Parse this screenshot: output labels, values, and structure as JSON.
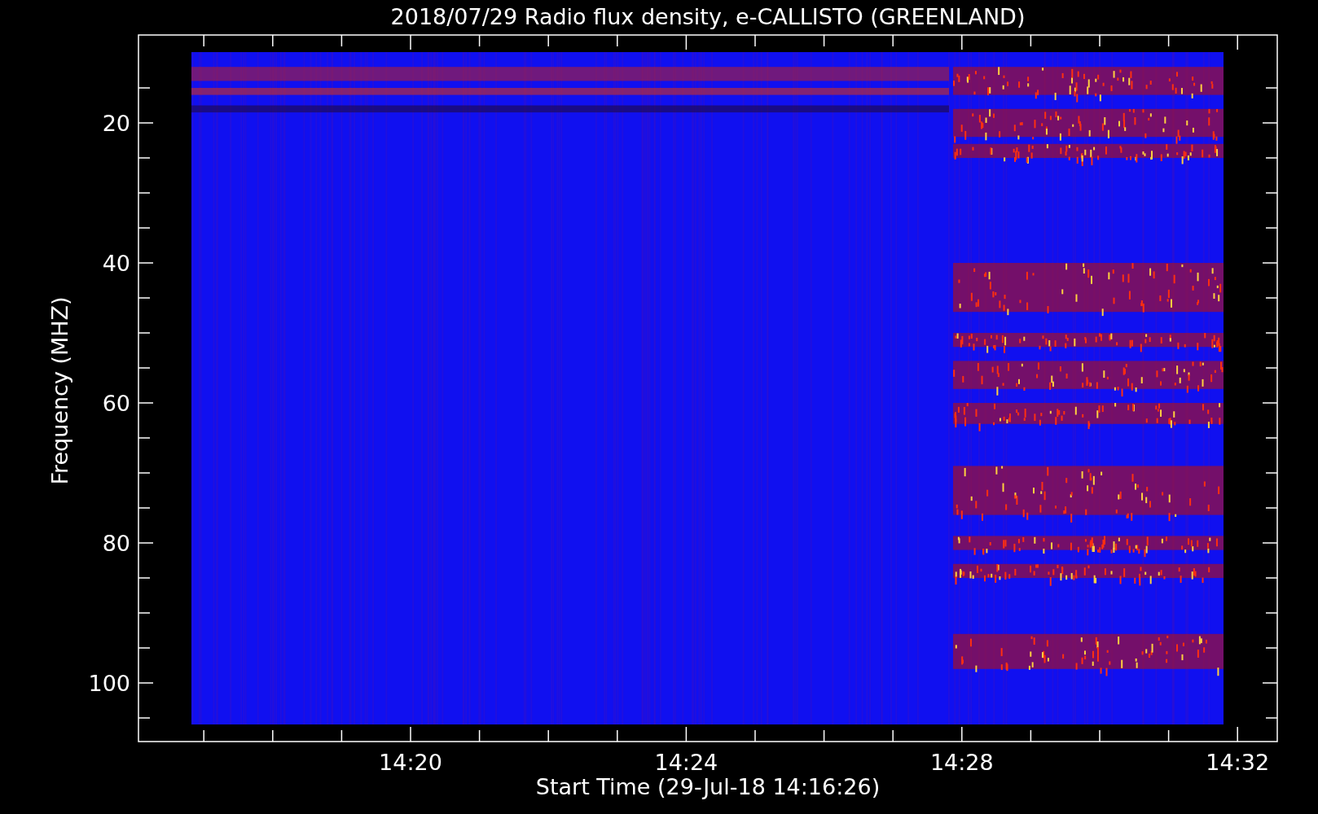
{
  "title": "2018/07/29  Radio flux density, e-CALLISTO (GREENLAND)",
  "y_axis": {
    "label": "Frequency (MHZ)",
    "ticks": [
      "20",
      "40",
      "60",
      "80",
      "100"
    ]
  },
  "x_axis": {
    "label": "Start Time (29-Jul-18 14:16:26)",
    "ticks": [
      "14:20",
      "14:24",
      "14:28",
      "14:32"
    ]
  }
}
